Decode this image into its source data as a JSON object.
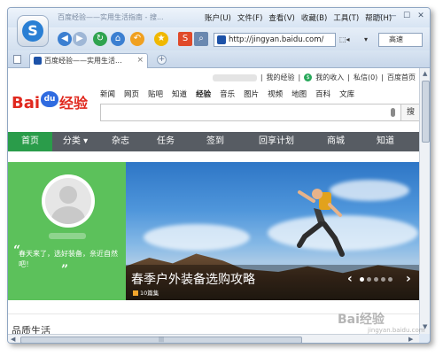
{
  "browser": {
    "window_title": "百度经验——实用生活指南 - 搜...",
    "menu": [
      "账户(U)",
      "文件(F)",
      "查看(V)",
      "收藏(B)",
      "工具(T)",
      "帮助(H)"
    ],
    "window_controls": [
      "▭",
      "—",
      "☐",
      "✕"
    ],
    "toolbar": {
      "back_icon": "back-arrow",
      "forward_icon": "forward-arrow",
      "refresh_icon": "refresh",
      "home_icon": "home",
      "undo_icon": "undo",
      "favorite_icon": "star",
      "address": "http://jingyan.baidu.com/",
      "speed_label": "高速"
    },
    "tab": {
      "title": "百度经验——实用生活...",
      "close": "×"
    },
    "new_tab": "+"
  },
  "page": {
    "user_links": [
      "我的经验",
      "我的收入",
      "私信(0)",
      "百度首页"
    ],
    "brand": {
      "left": "Bai",
      "paw": "du",
      "right": "经验"
    },
    "top_nav": [
      "新闻",
      "网页",
      "贴吧",
      "知道",
      "经验",
      "音乐",
      "图片",
      "视频",
      "地图",
      "百科",
      "文库"
    ],
    "active_top_nav": "经验",
    "search_button": "搜",
    "main_nav": [
      "首页",
      "分类 ▾",
      "杂志",
      "任务",
      "签到",
      "回享计划",
      "商城",
      "知道"
    ],
    "active_main_nav": "首页",
    "hero": {
      "quote": "春天来了，选好装备，亲近自然吧！",
      "caption": "春季户外装备选购攻略",
      "sub": "10篇集",
      "prev": "‹",
      "next": "›"
    },
    "section_title": "品质生活"
  },
  "watermark": {
    "text": "Bai经验",
    "sub": "jingyan.baidu.com"
  },
  "colors": {
    "baidu_red": "#e0281e",
    "baidu_blue": "#2f6be0",
    "nav_active": "#2a9c4a",
    "panel_green": "#5cc15b"
  }
}
